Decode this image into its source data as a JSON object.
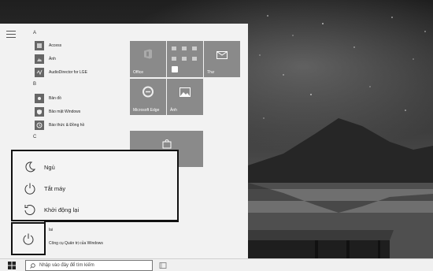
{
  "start_menu": {
    "sections": [
      {
        "letter": "A",
        "items": [
          {
            "label": "Access",
            "icon": "access-icon"
          },
          {
            "label": "Ảnh",
            "icon": "photos-icon"
          },
          {
            "label": "AudioDirector for LGE",
            "icon": "audio-icon"
          }
        ]
      },
      {
        "letter": "B",
        "items": [
          {
            "label": "Bản đồ",
            "icon": "maps-icon"
          },
          {
            "label": "Bảo mật Windows",
            "icon": "shield-icon"
          },
          {
            "label": "Báo thức & Đồng hồ",
            "icon": "clock-icon"
          }
        ]
      },
      {
        "letter": "C",
        "items": []
      }
    ],
    "tiles": {
      "office": "Office",
      "thu": "Thư",
      "edge": "Microsoft Edge",
      "anh": "Ảnh"
    },
    "behind_items": [
      "lai",
      "Công cụ Quản trị của Windows"
    ]
  },
  "power_flyout": {
    "items": [
      {
        "label": "Ngủ",
        "icon": "moon-icon"
      },
      {
        "label": "Tắt máy",
        "icon": "power-icon"
      },
      {
        "label": "Khởi động lại",
        "icon": "restart-icon"
      }
    ]
  },
  "taskbar": {
    "search_placeholder": "Nhập vào đây để tìm kiếm"
  }
}
